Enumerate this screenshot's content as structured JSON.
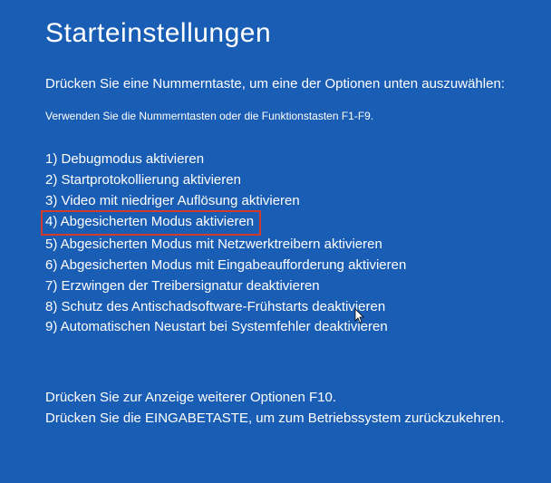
{
  "title": "Starteinstellungen",
  "instruction": "Drücken Sie eine Nummerntaste, um eine der Optionen unten auszuwählen:",
  "hint": "Verwenden Sie die Nummerntasten oder die Funktionstasten F1-F9.",
  "options": {
    "o1": "1) Debugmodus aktivieren",
    "o2": "2) Startprotokollierung aktivieren",
    "o3": "3) Video mit niedriger Auflösung aktivieren",
    "o4": "4) Abgesicherten Modus aktivieren",
    "o5": "5) Abgesicherten Modus mit Netzwerktreibern aktivieren",
    "o6": "6) Abgesicherten Modus mit Eingabeaufforderung aktivieren",
    "o7": "7) Erzwingen der Treibersignatur deaktivieren",
    "o8": "8) Schutz des Antischadsoftware-Frühstarts deaktivieren",
    "o9": "9) Automatischen Neustart bei Systemfehler deaktivieren"
  },
  "footer": {
    "line1": "Drücken Sie zur Anzeige weiterer Optionen F10.",
    "line2": "Drücken Sie die EINGABETASTE, um zum Betriebssystem zurückzukehren."
  }
}
